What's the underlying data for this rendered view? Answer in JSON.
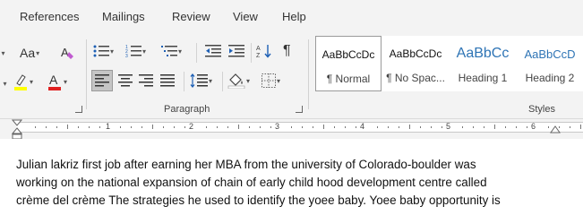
{
  "tabs": [
    "References",
    "Mailings",
    "Review",
    "View",
    "Help"
  ],
  "ribbon": {
    "font_group": {
      "change_case_label": "Aa",
      "font_color_letter": "A",
      "highlight_color": "#ffff00",
      "font_color": "#e02020"
    },
    "paragraph_group": {
      "label": "Paragraph",
      "show_marks_glyph": "¶"
    },
    "styles_group": {
      "label": "Styles",
      "items": [
        {
          "sample": "AaBbCcDc",
          "name": "¶ Normal",
          "selected": true
        },
        {
          "sample": "AaBbCcDc",
          "name": "¶ No Spac..."
        },
        {
          "sample": "AaBbCc",
          "name": "Heading 1"
        },
        {
          "sample": "AaBbCcD",
          "name": "Heading 2"
        }
      ]
    }
  },
  "ruler": {
    "numbers": [
      "1",
      "2",
      "3",
      "4",
      "5",
      "6"
    ]
  },
  "document": {
    "lines": [
      "Julian lakriz first job after earning her MBA from the university of Colorado-boulder was",
      "working on the national expansion of chain of early child hood development centre called",
      "crème del crème The strategies he used to identify the yoee baby. Yoee baby opportunity is"
    ]
  },
  "colors": {
    "heading_blue": "#2e74b5",
    "ribbon_bg": "#f3f3f3"
  }
}
